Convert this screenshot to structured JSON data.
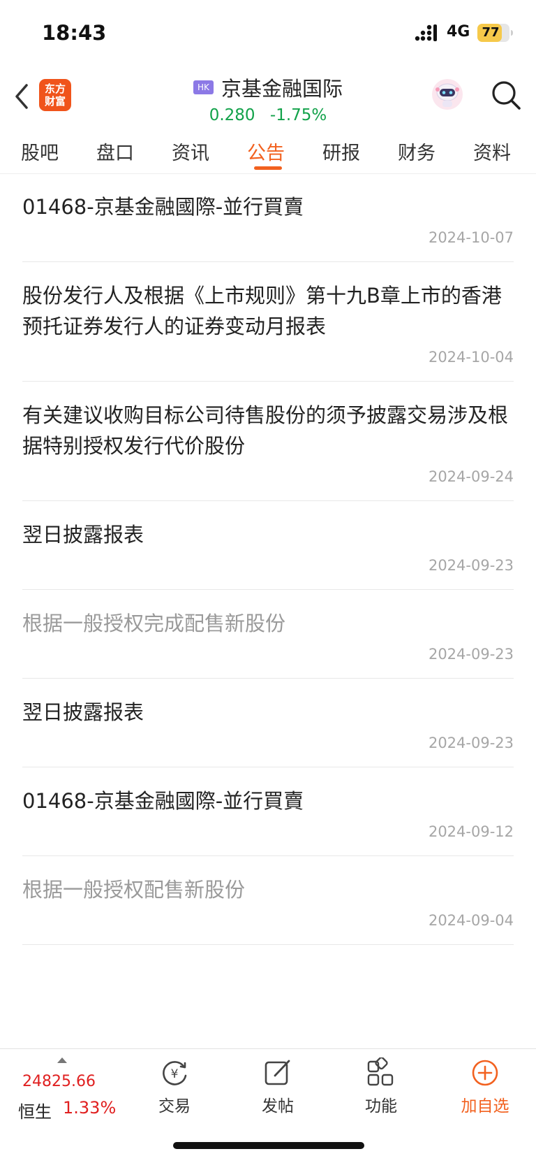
{
  "status_bar": {
    "time": "18:43",
    "network": "4G",
    "battery": "77",
    "battery_level": 0.77
  },
  "header": {
    "logo_line1": "东方",
    "logo_line2": "财富",
    "market_badge": "HK",
    "stock_name": "京基金融国际",
    "price": "0.280",
    "change": "-1.75%",
    "colors": {
      "down": "#12a24a",
      "accent": "#f2611f",
      "logo": "#f0541b"
    }
  },
  "tabs": [
    {
      "label": "股吧"
    },
    {
      "label": "盘口"
    },
    {
      "label": "资讯"
    },
    {
      "label": "公告",
      "active": true
    },
    {
      "label": "研报"
    },
    {
      "label": "财务"
    },
    {
      "label": "资料"
    }
  ],
  "announcements": [
    {
      "title": "01468-京基金融國際-並行買賣",
      "date": "2024-10-07",
      "read": false
    },
    {
      "title": "股份发行人及根据《上市规则》第十九B章上市的香港预托证券发行人的证券变动月报表",
      "date": "2024-10-04",
      "read": false
    },
    {
      "title": "有关建议收购目标公司待售股份的须予披露交易涉及根据特别授权发行代价股份",
      "date": "2024-09-24",
      "read": false
    },
    {
      "title": "翌日披露报表",
      "date": "2024-09-23",
      "read": false
    },
    {
      "title": "根据一般授权完成配售新股份",
      "date": "2024-09-23",
      "read": true
    },
    {
      "title": "翌日披露报表",
      "date": "2024-09-23",
      "read": false
    },
    {
      "title": "01468-京基金融國際-並行買賣",
      "date": "2024-09-12",
      "read": false
    },
    {
      "title": "根据一般授权配售新股份",
      "date": "2024-09-04",
      "read": true
    }
  ],
  "bottom_bar": {
    "index_value": "24825.66",
    "index_name": "恒生",
    "index_change": "1.33%",
    "trade": "交易",
    "post": "发帖",
    "functions": "功能",
    "add_watchlist": "加自选"
  }
}
